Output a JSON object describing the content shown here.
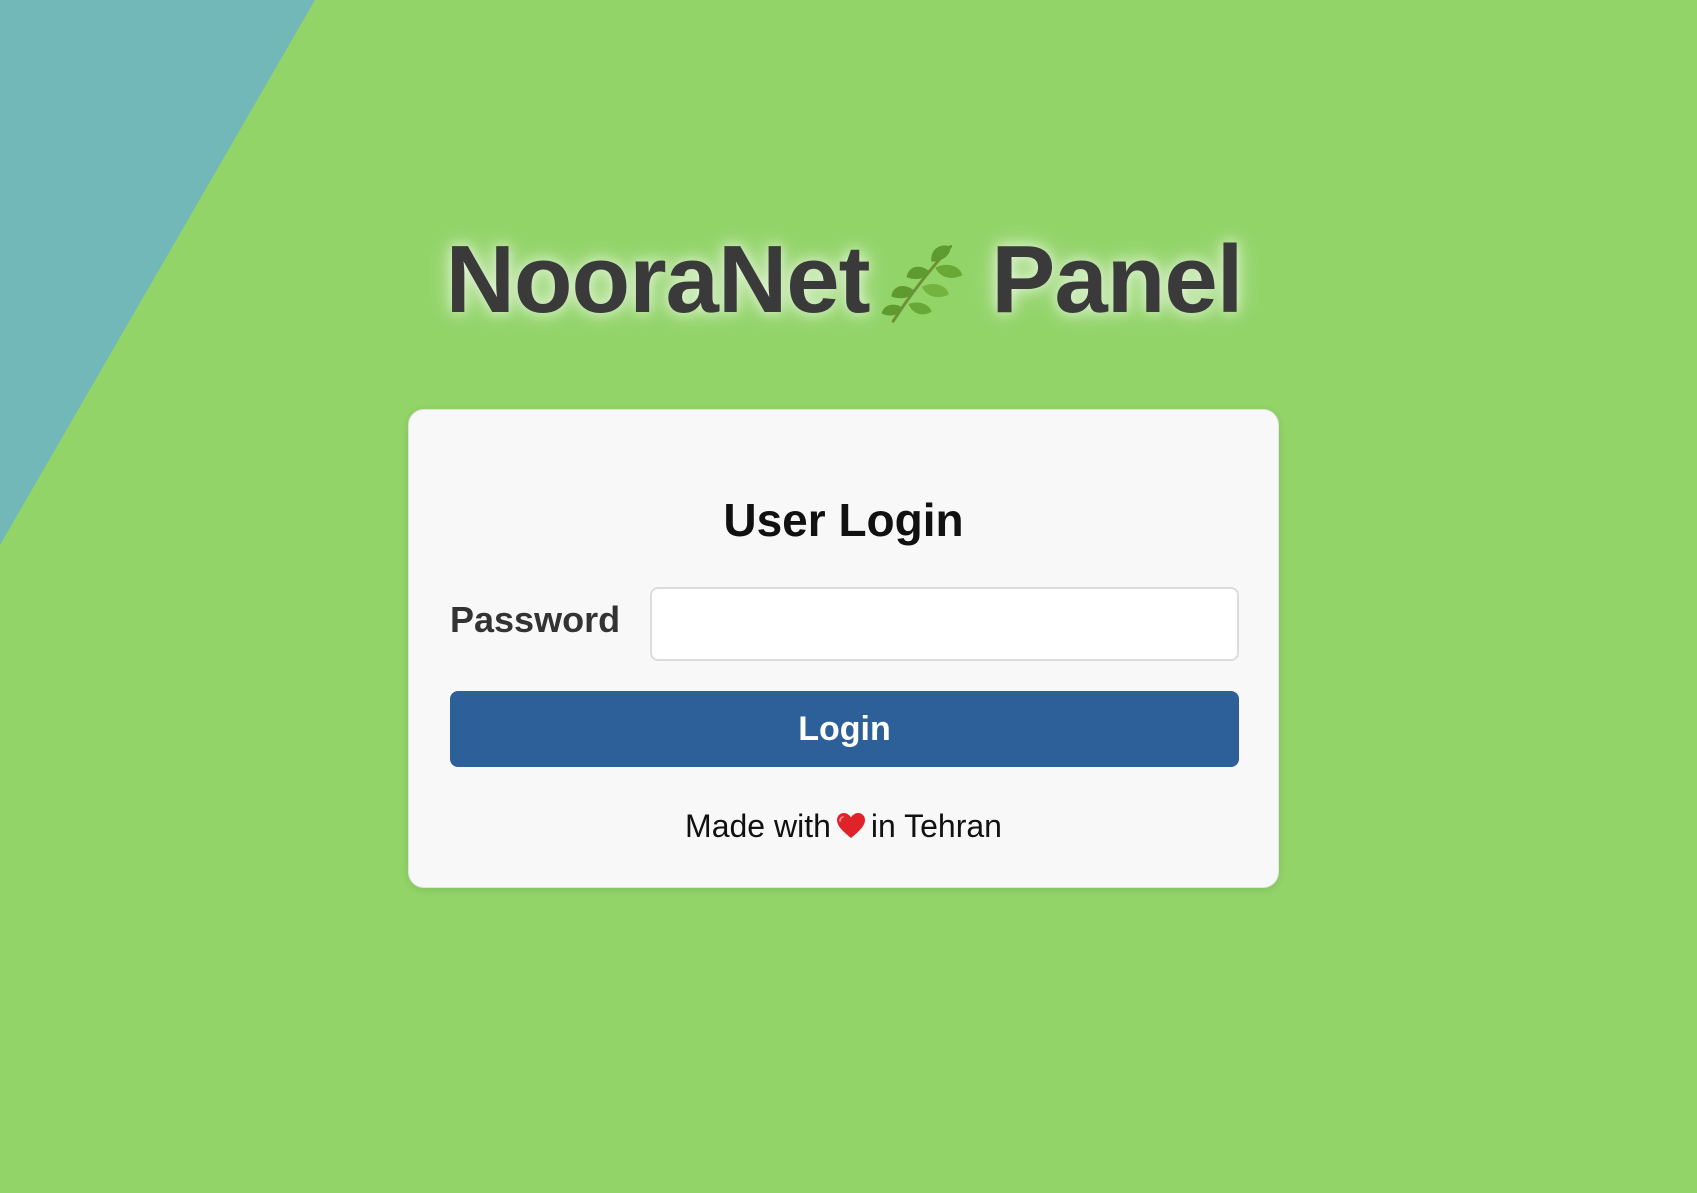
{
  "background": {
    "color": "#92d468",
    "corner_color": "#72b8b8"
  },
  "header": {
    "brand_name": "NooraNet",
    "brand_icon": "leaf-icon",
    "suffix": "Panel"
  },
  "login_card": {
    "title": "User Login",
    "password_label": "Password",
    "password_value": "",
    "password_placeholder": "",
    "button_label": "Login",
    "button_color": "#2d6099",
    "footer": {
      "prefix": "Made with",
      "icon": "heart-icon",
      "suffix": "in Tehran"
    }
  }
}
